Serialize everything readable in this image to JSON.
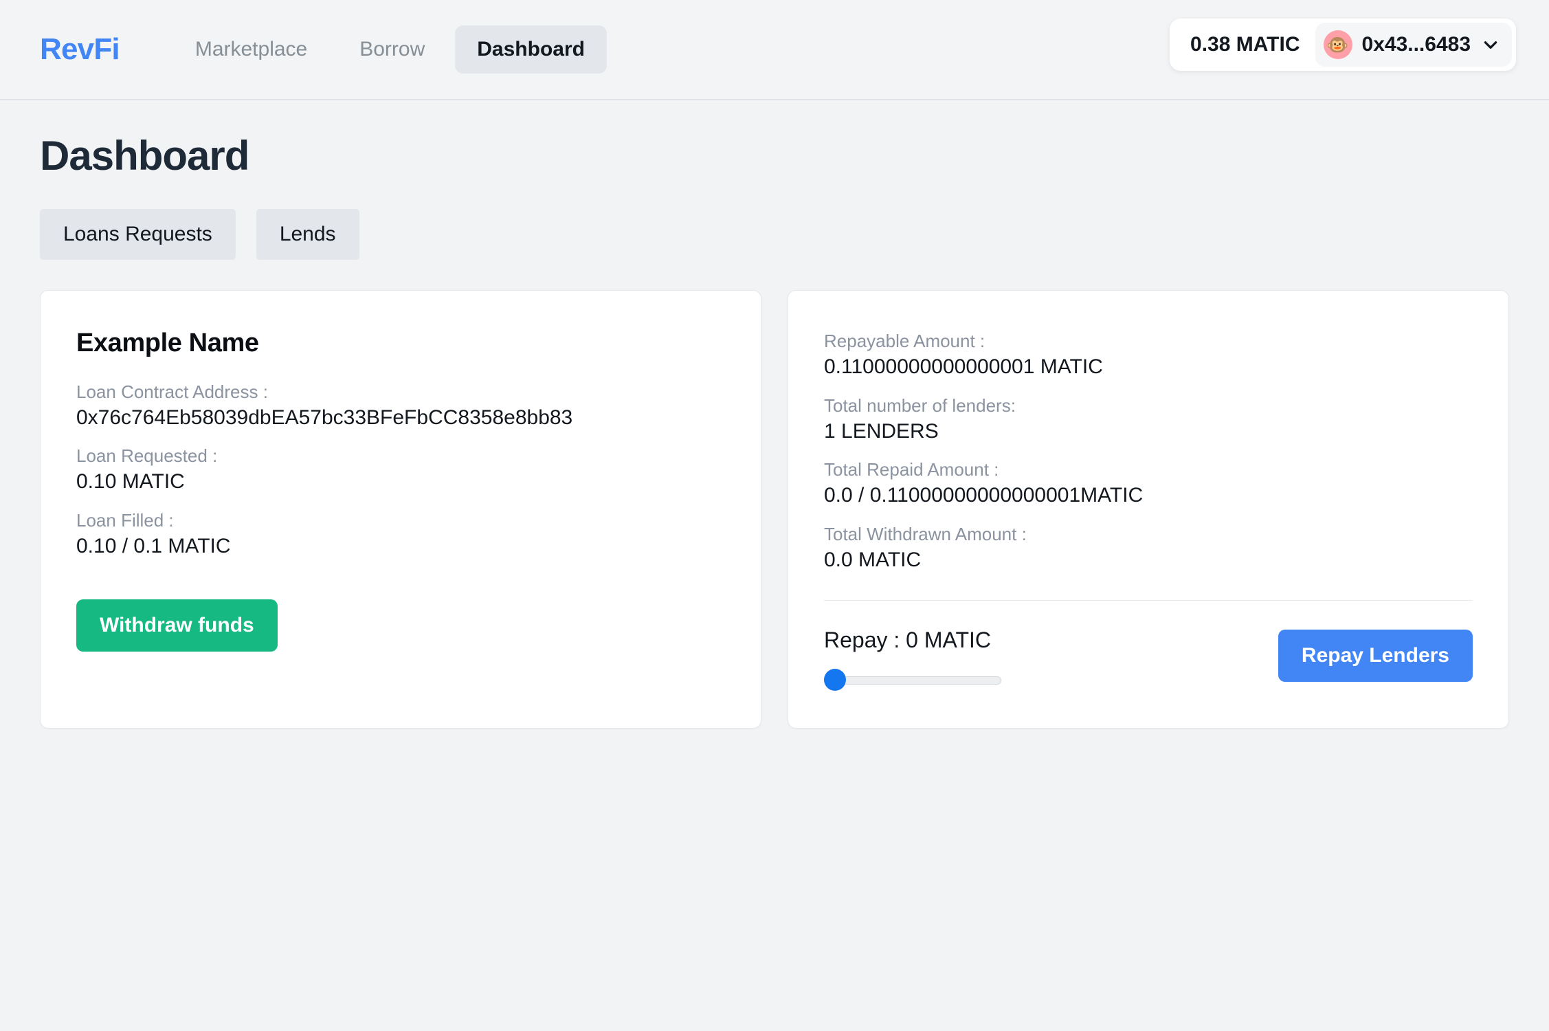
{
  "navbar": {
    "brand": "RevFi",
    "links": [
      {
        "label": "Marketplace",
        "active": false
      },
      {
        "label": "Borrow",
        "active": false
      },
      {
        "label": "Dashboard",
        "active": true
      }
    ],
    "wallet": {
      "balance": "0.38 MATIC",
      "avatar_emoji": "🐵",
      "avatar_color": "#ffa0a8",
      "address": "0x43...6483",
      "chevron_icon": "chevron-down-icon"
    }
  },
  "page": {
    "title": "Dashboard",
    "tabs": [
      {
        "label": "Loans Requests"
      },
      {
        "label": "Lends"
      }
    ]
  },
  "loan_card": {
    "title": "Example Name",
    "fields": [
      {
        "label": "Loan Contract Address :",
        "value": "0x76c764Eb58039dbEA57bc33BFeFbCC8358e8bb83"
      },
      {
        "label": "Loan Requested :",
        "value": "0.10 MATIC"
      },
      {
        "label": "Loan Filled :",
        "value": "0.10 / 0.1 MATIC"
      }
    ],
    "withdraw_button": "Withdraw funds",
    "withdraw_color": "#16b981"
  },
  "repay_card": {
    "fields": [
      {
        "label": "Repayable Amount :",
        "value": "0.11000000000000001 MATIC"
      },
      {
        "label": "Total number of lenders:",
        "value": "1 LENDERS"
      },
      {
        "label": "Total Repaid Amount :",
        "value": "0.0 / 0.11000000000000001MATIC"
      },
      {
        "label": "Total Withdrawn Amount :",
        "value": "0.0 MATIC"
      }
    ],
    "repay_label": "Repay : 0 MATIC",
    "slider": {
      "value": 0,
      "min": 0,
      "max": 100
    },
    "repay_button": "Repay Lenders",
    "repay_color": "#4285f4"
  }
}
